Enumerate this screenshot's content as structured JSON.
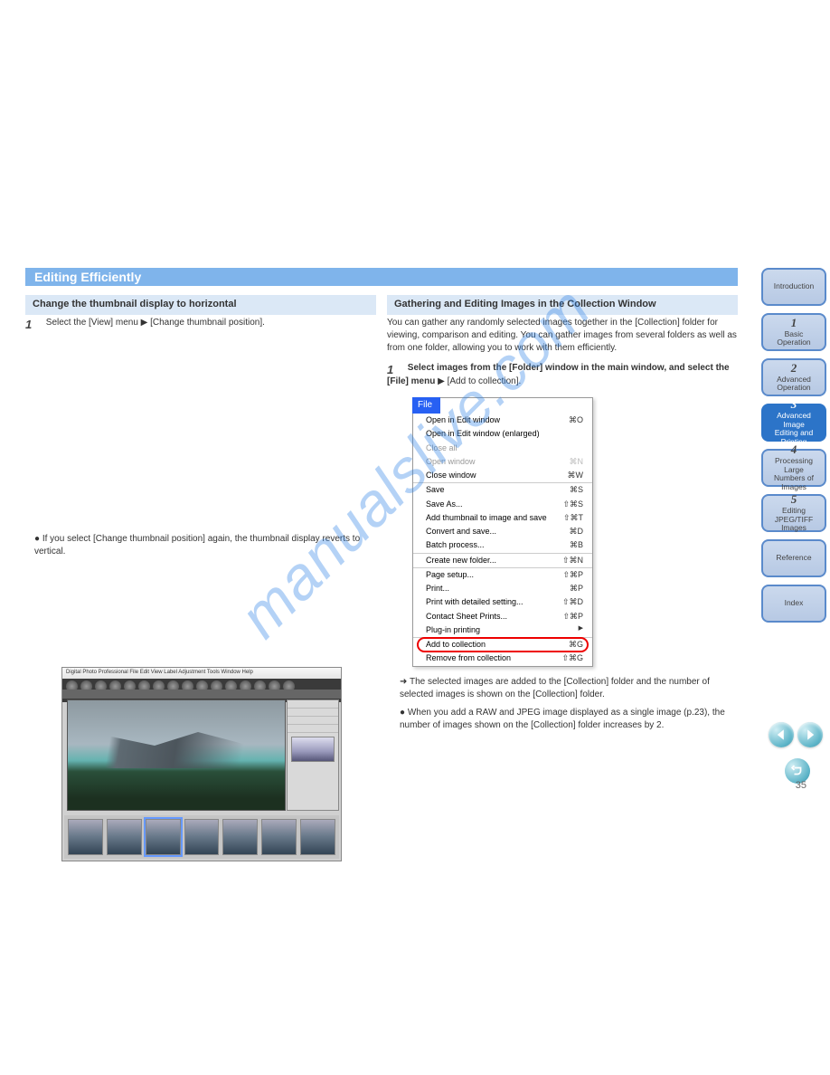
{
  "watermark": "manualslive.com",
  "title": "Editing Efficiently",
  "col1": {
    "head": "Change the thumbnail display to horizontal",
    "step1_label": "Select the [View] menu ▶ [Change thumbnail position].",
    "note": "If you select [Change thumbnail position] again, the thumbnail display reverts to vertical."
  },
  "col2": {
    "head": "Gathering and Editing Images in the Collection Window",
    "intro": "You can gather any randomly selected images together in the [Collection] folder for viewing, comparison and editing. You can gather images from several folders as well as from one folder, allowing you to work with them efficiently.",
    "step1_bold": "Select images from the [Folder] window in the main window, and select the [File] menu",
    "step1_tail": " ▶ [Add to collection].",
    "bullets": [
      "The selected images are added to the [Collection] folder and the number of selected images is shown on the [Collection] folder.",
      "When you add a RAW and JPEG image displayed as a single image (p.23), the number of images shown on the [Collection] folder increases by 2."
    ]
  },
  "file_menu": {
    "tab": "File",
    "items": [
      {
        "label": "Open in Edit window",
        "sc": "⌘O"
      },
      {
        "label": "Open in Edit window (enlarged)",
        "sc": ""
      },
      {
        "label": "Close all",
        "sc": "",
        "dim": true
      },
      {
        "label": "Open window",
        "sc": "⌘N",
        "dim": true
      },
      {
        "label": "Close window",
        "sc": "⌘W"
      },
      {
        "sep": true
      },
      {
        "label": "Save",
        "sc": "⌘S"
      },
      {
        "label": "Save As...",
        "sc": "⇧⌘S"
      },
      {
        "label": "Add thumbnail to image and save",
        "sc": "⇧⌘T"
      },
      {
        "label": "Convert and save...",
        "sc": "⌘D"
      },
      {
        "label": "Batch process...",
        "sc": "⌘B"
      },
      {
        "sep": true
      },
      {
        "label": "Create new folder...",
        "sc": "⇧⌘N"
      },
      {
        "sep": true
      },
      {
        "label": "Page setup...",
        "sc": "⇧⌘P"
      },
      {
        "label": "Print...",
        "sc": "⌘P"
      },
      {
        "label": "Print with detailed setting...",
        "sc": "⇧⌘D"
      },
      {
        "label": "Contact Sheet Prints...",
        "sc": "⇧⌘P"
      },
      {
        "label": "Plug-in printing",
        "sc": "",
        "sub": true
      },
      {
        "sep": true
      },
      {
        "label": "Add to collection",
        "sc": "⌘G",
        "hl": true
      },
      {
        "label": "Remove from collection",
        "sc": "⇧⌘G"
      }
    ]
  },
  "nav": [
    {
      "label": "Introduction"
    },
    {
      "num": "1",
      "lines": [
        "Basic",
        "Operation"
      ]
    },
    {
      "num": "2",
      "lines": [
        "Advanced",
        "Operation"
      ]
    },
    {
      "num": "3",
      "lines": [
        "Advanced Image",
        "Editing and Printing"
      ],
      "active": true
    },
    {
      "num": "4",
      "lines": [
        "Processing Large",
        "Numbers of",
        "Images"
      ]
    },
    {
      "num": "5",
      "lines": [
        "Editing",
        "JPEG/TIFF",
        "Images"
      ]
    },
    {
      "label": "Reference"
    },
    {
      "label": "Index"
    }
  ],
  "page_number": "35",
  "mac_menubar": "Digital Photo Professional    File  Edit  View  Label  Adjustment  Tools  Window  Help"
}
